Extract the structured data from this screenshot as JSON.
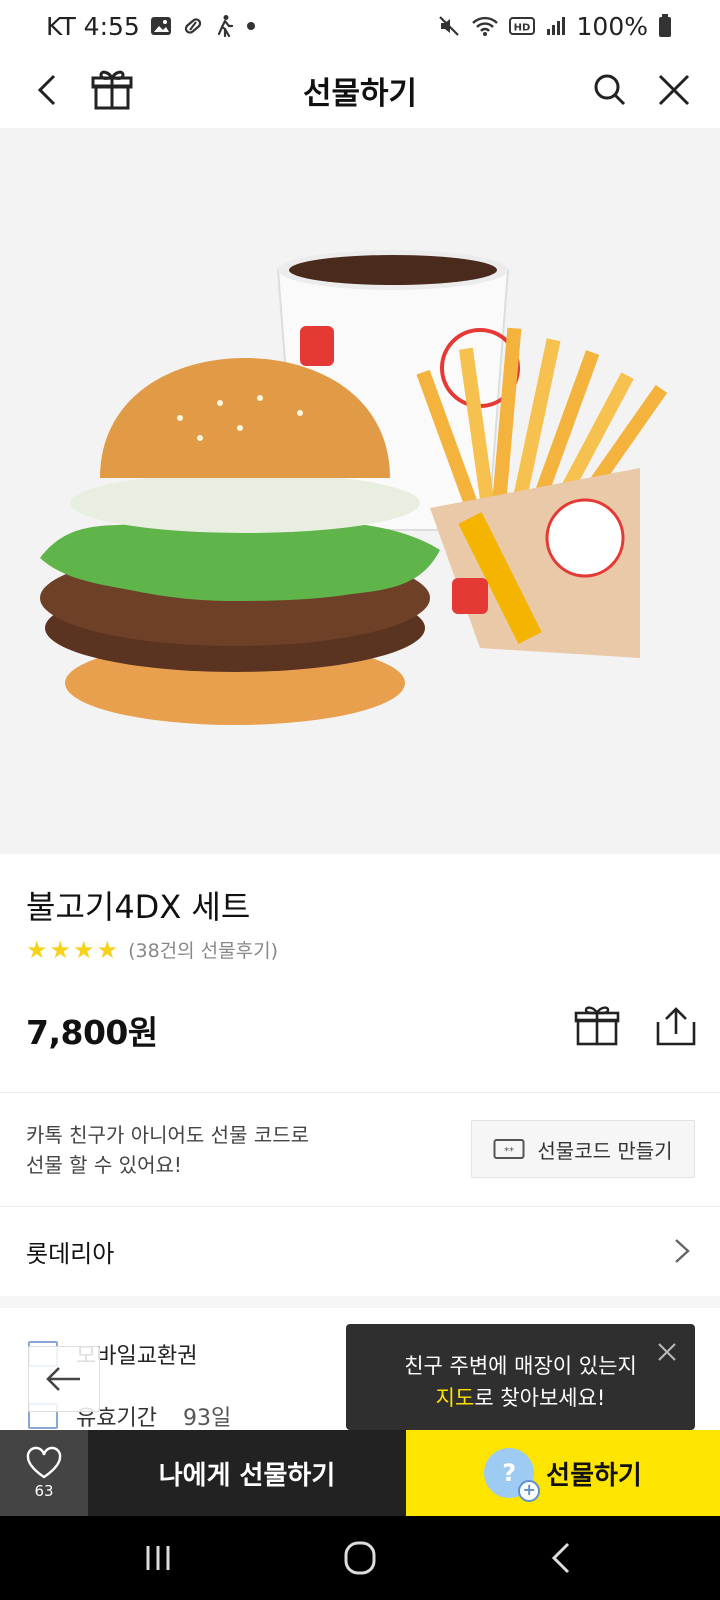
{
  "status": {
    "carrier_time": "KT 4:55",
    "battery": "100%"
  },
  "topbar": {
    "title": "선물하기"
  },
  "product": {
    "name": "불고기4DX 세트",
    "rating_stars": 4,
    "rating_text": "(38건의 선물후기)",
    "price": "7,800원"
  },
  "gift_code": {
    "desc_line1": "카톡 친구가 아니어도 선물 코드로",
    "desc_line2": "선물 할 수 있어요!",
    "button_label": "선물코드 만들기"
  },
  "brand": {
    "name": "롯데리아"
  },
  "info": {
    "type_label": "모바일교환권",
    "validity_label": "유효기간",
    "validity_value": "93일"
  },
  "tooltip": {
    "line1": "친구 주변에 매장이 있는지",
    "line2_highlight": "지도",
    "line2_rest": "로 찾아보세요!"
  },
  "bottom": {
    "like_count": "63",
    "self_gift_label": "나에게 선물하기",
    "gift_label": "선물하기"
  },
  "colors": {
    "accent_yellow": "#fee500",
    "star_yellow": "#f7d21b",
    "highlight": "#ffe100"
  }
}
